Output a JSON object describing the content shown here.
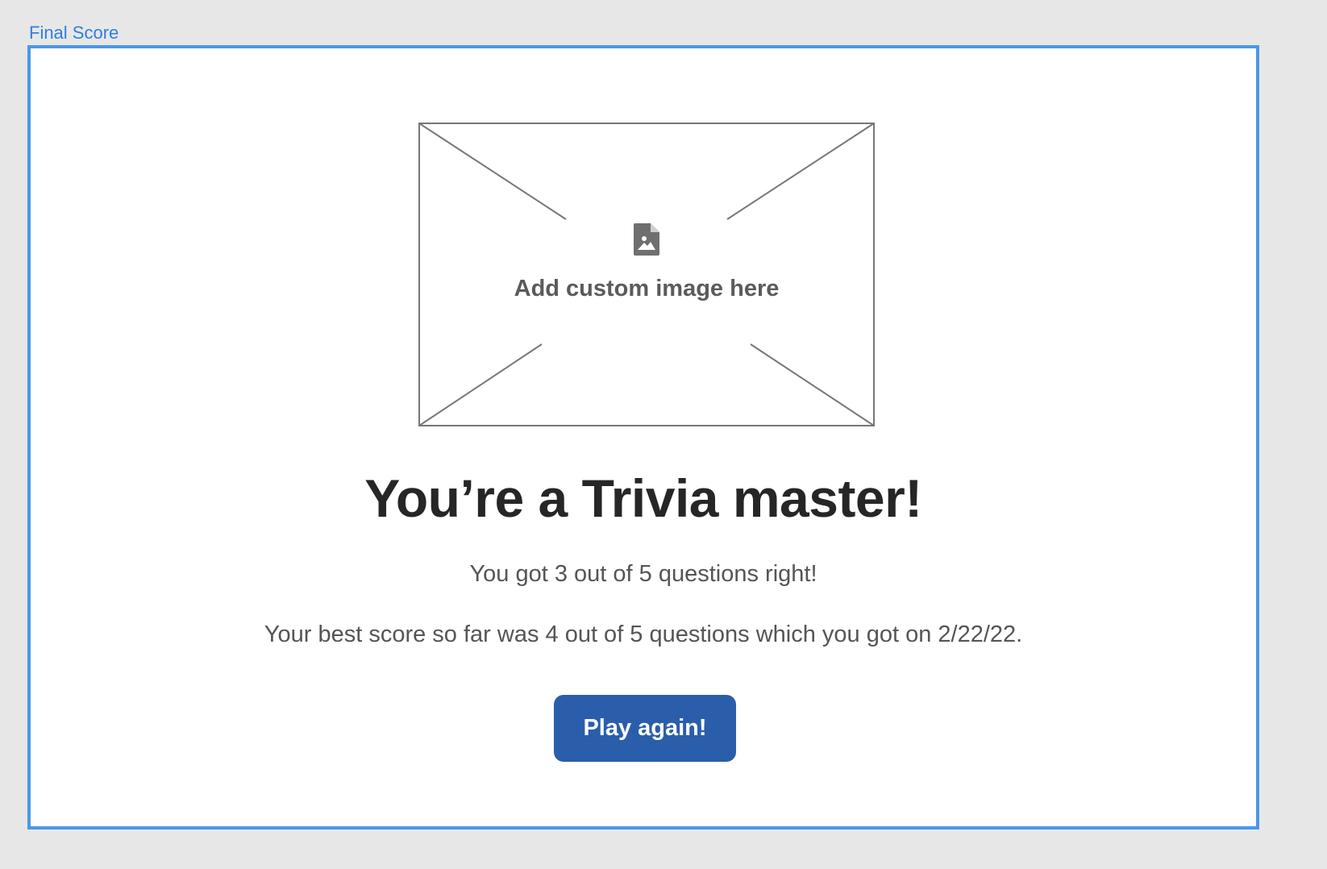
{
  "frame": {
    "label": "Final Score"
  },
  "image_placeholder": {
    "icon": "image-file-icon",
    "text": "Add custom image here"
  },
  "result": {
    "headline": "You’re a Trivia master!",
    "score_text": "You got 3 out of 5 questions right!",
    "best_score_text": "Your best score so far was 4 out of 5 questions which you got on 2/22/22."
  },
  "actions": {
    "play_again_label": "Play again!"
  },
  "colors": {
    "frame_border": "#4a97ec",
    "frame_label": "#2f7ee3",
    "button_bg": "#2a5eab",
    "heading": "#262626",
    "body_text": "#555555",
    "canvas_bg": "#e7e7e7"
  }
}
